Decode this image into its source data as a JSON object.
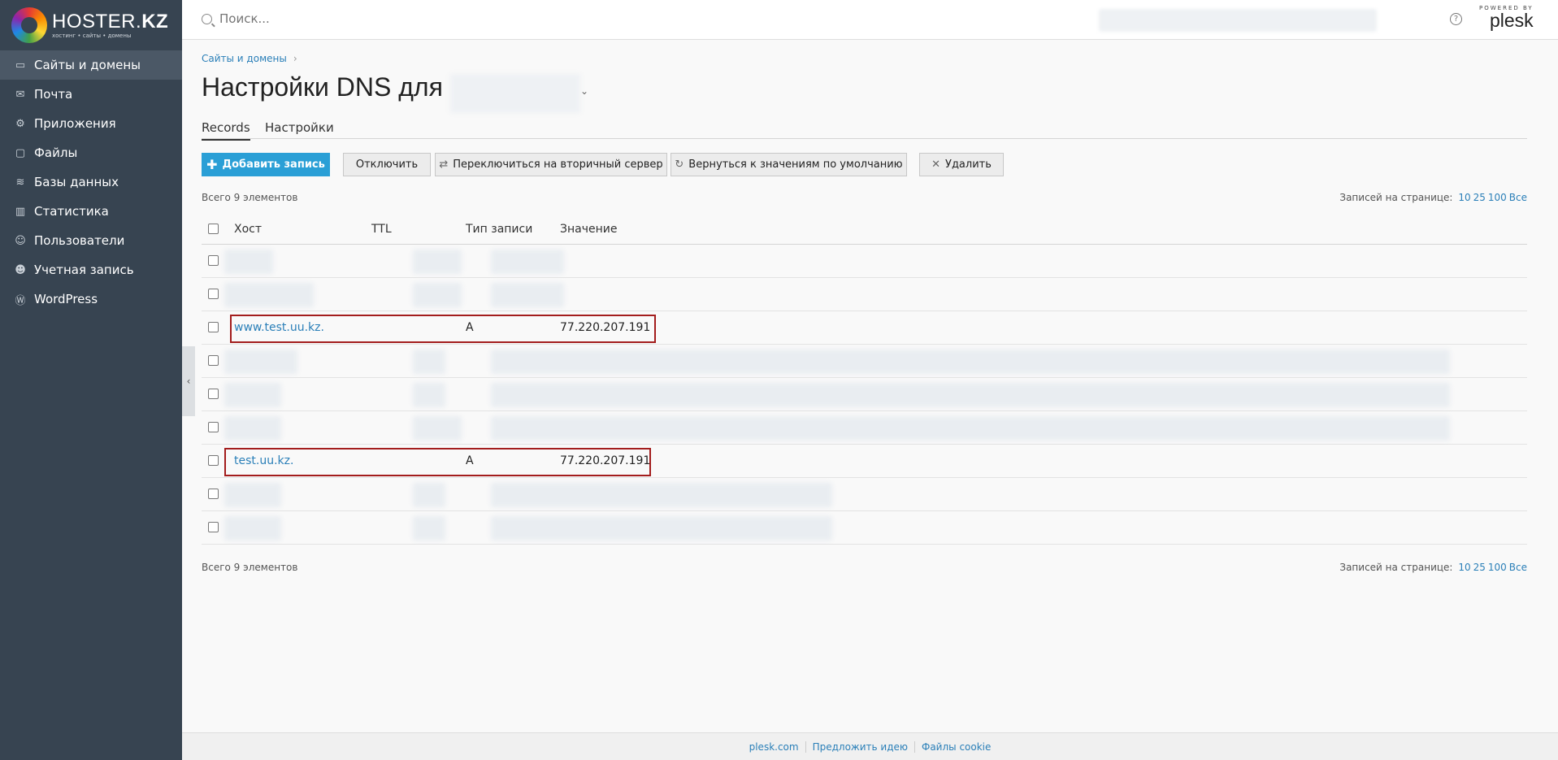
{
  "brand": {
    "name_light": "HOSTER.",
    "name_bold": "KZ",
    "tagline": "хостинг • сайты • домены"
  },
  "sidebar": {
    "items": [
      {
        "label": "Сайты и домены",
        "icon": "monitor-icon",
        "glyph": "▭",
        "active": true
      },
      {
        "label": "Почта",
        "icon": "mail-icon",
        "glyph": "✉"
      },
      {
        "label": "Приложения",
        "icon": "gear-icon",
        "glyph": "⚙"
      },
      {
        "label": "Файлы",
        "icon": "folder-icon",
        "glyph": "▢"
      },
      {
        "label": "Базы данных",
        "icon": "database-icon",
        "glyph": "≋"
      },
      {
        "label": "Статистика",
        "icon": "chart-icon",
        "glyph": "▥"
      },
      {
        "label": "Пользователи",
        "icon": "user-icon",
        "glyph": "☺"
      },
      {
        "label": "Учетная запись",
        "icon": "account-icon",
        "glyph": "☻"
      },
      {
        "label": "WordPress",
        "icon": "wordpress-icon",
        "glyph": "Ⓦ"
      }
    ]
  },
  "topbar": {
    "search_placeholder": "Поиск...",
    "powered_by": "POWERED BY",
    "plesk": "plesk"
  },
  "breadcrumb": {
    "item": "Сайты и домены"
  },
  "page": {
    "title": "Настройки DNS для"
  },
  "tabs": [
    {
      "label": "Records",
      "active": true
    },
    {
      "label": "Настройки"
    }
  ],
  "toolbar": {
    "add": "Добавить запись",
    "disable": "Отключить",
    "switch_secondary": "Переключиться на вторичный сервер",
    "restore_defaults": "Вернуться к значениям по умолчанию",
    "delete": "Удалить"
  },
  "list": {
    "total": "Всего 9 элементов",
    "per_page_label": "Записей на странице:",
    "per_page_options": [
      "10",
      "25",
      "100",
      "Все"
    ]
  },
  "table": {
    "columns": {
      "host": "Хост",
      "ttl": "TTL",
      "type": "Тип записи",
      "value": "Значение"
    },
    "rows": [
      {
        "host": "",
        "type": "",
        "value": "",
        "blurred": true
      },
      {
        "host": "",
        "type": "",
        "value": "",
        "blurred": true
      },
      {
        "host": "www.test.uu.kz.",
        "ttl": "",
        "type": "A",
        "value": "77.220.207.191",
        "highlighted": true
      },
      {
        "host": "",
        "type": "",
        "value": "",
        "blurred": true
      },
      {
        "host": "",
        "type": "",
        "value": "",
        "blurred": true
      },
      {
        "host": "",
        "type": "",
        "value": "",
        "blurred": true
      },
      {
        "host": "test.uu.kz.",
        "ttl": "",
        "type": "A",
        "value": "77.220.207.191",
        "highlighted": true
      },
      {
        "host": "",
        "type": "",
        "value": "",
        "blurred": true
      },
      {
        "host": "",
        "type": "",
        "value": "",
        "blurred": true
      }
    ]
  },
  "footer": {
    "links": [
      "plesk.com",
      "Предложить идею",
      "Файлы cookie"
    ]
  },
  "colors": {
    "sidebar_bg": "#374451",
    "primary": "#2a9fd6",
    "link": "#2a7fb8",
    "highlight_border": "#a31d1d"
  }
}
